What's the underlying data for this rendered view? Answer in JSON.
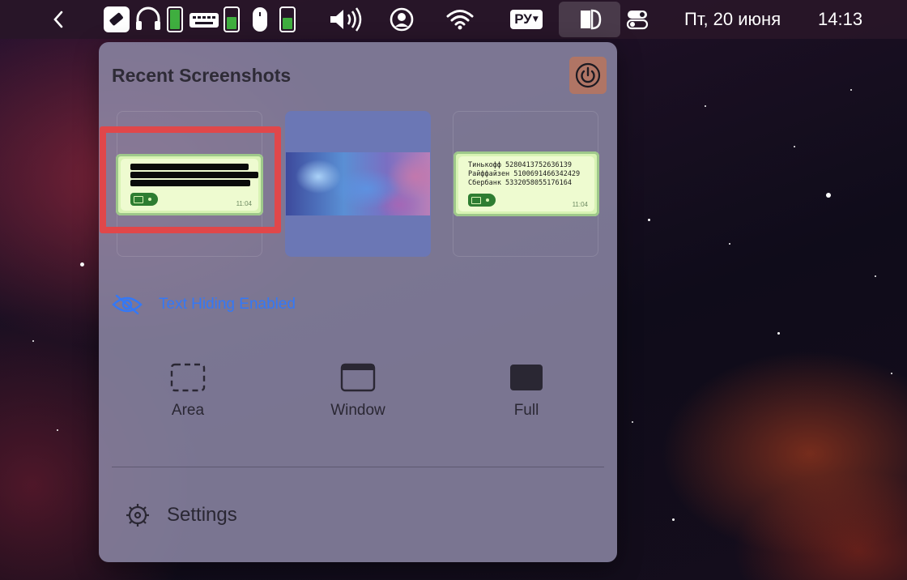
{
  "menubar": {
    "keyboard_layout": "РУ",
    "date": "Пт, 20 июня",
    "time": "14:13",
    "icons": [
      "chevron-left-icon",
      "dongle-icon",
      "headphones-icon",
      "keyboard-icon",
      "mouse-icon",
      "volume-icon",
      "user-icon",
      "wifi-icon",
      "app-icon",
      "control-center-icon"
    ]
  },
  "panel": {
    "title": "Recent Screenshots",
    "thumbnails": [
      {
        "kind": "chat-redacted",
        "time": "11:04"
      },
      {
        "kind": "space-image"
      },
      {
        "kind": "chat-text",
        "time": "11:04",
        "lines": [
          "Тинькофф 5280413752636139",
          "Райффайзен 5100691466342429",
          "Сбербанк 5332058055176164"
        ]
      }
    ],
    "text_hiding_label": "Text Hiding Enabled",
    "capture_modes": [
      {
        "label": "Area"
      },
      {
        "label": "Window"
      },
      {
        "label": "Full"
      }
    ],
    "settings_label": "Settings"
  },
  "colors": {
    "accent": "#3478f6",
    "highlight": "#e0474a",
    "selected": "#6b77b5"
  }
}
